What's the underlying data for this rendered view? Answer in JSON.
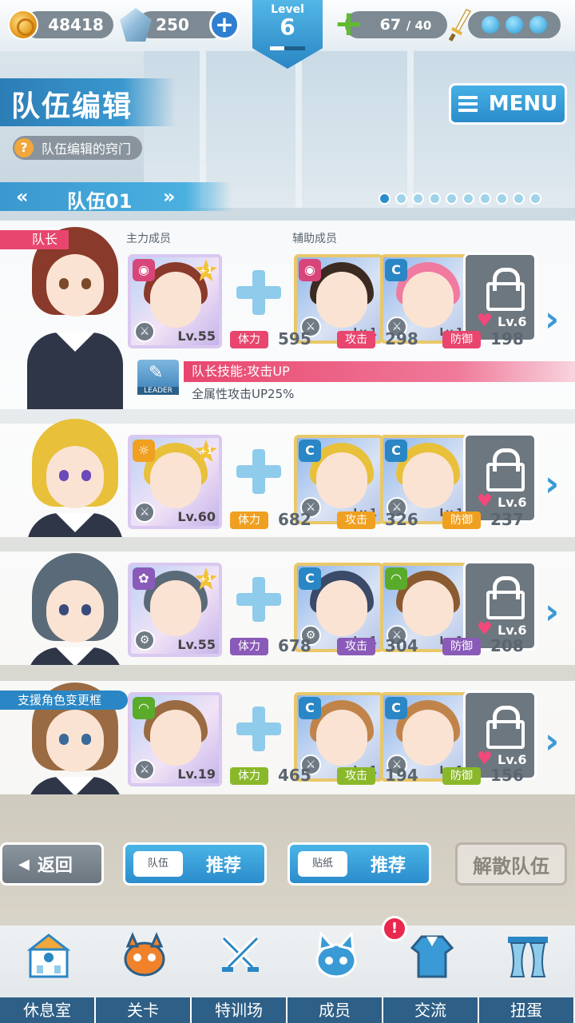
{
  "header": {
    "coins": "48418",
    "gems": "250",
    "level_label": "Level",
    "level_value": "6",
    "level_progress": 0.4,
    "stamina_current": "67",
    "stamina_max": "/ 40"
  },
  "page": {
    "title": "队伍编辑",
    "hint": "队伍编辑的窍门",
    "menu_label": "MENU",
    "team_name": "队伍01",
    "prev_arrow": "«",
    "next_arrow": "»",
    "page_dots": 10,
    "active_dot": 0
  },
  "labels": {
    "main_member": "主力成员",
    "support_member": "辅助成员",
    "leader": "队长",
    "support_change": "支援角色变更框",
    "hp": "体力",
    "atk": "攻击",
    "def": "防御",
    "leader_badge": "LEADER"
  },
  "leader_skill": {
    "name": "队长技能:攻击UP",
    "desc": "全属性攻击UP25%"
  },
  "rows": [
    {
      "main_level": "Lv.55",
      "main_plus": "+1",
      "sub1_level": "Lv.1",
      "sub2_level": "Lv.1",
      "lock_level": "Lv.6",
      "hp": "595",
      "atk": "298",
      "def": "198",
      "tag_color": "#e8466e",
      "attr_color": "#d8457a"
    },
    {
      "main_level": "Lv.60",
      "main_plus": "+1",
      "sub1_level": "Lv.1",
      "sub2_level": "Lv.1",
      "lock_level": "Lv.6",
      "hp": "682",
      "atk": "326",
      "def": "237",
      "tag_color": "#f0a020",
      "attr_color": "#f0a020"
    },
    {
      "main_level": "Lv.55",
      "main_plus": "+1",
      "sub1_level": "Lv.1",
      "sub2_level": "Lv.1",
      "lock_level": "Lv.6",
      "hp": "678",
      "atk": "304",
      "def": "208",
      "tag_color": "#8a5ab8",
      "attr_color": "#8a5ab8"
    },
    {
      "main_level": "Lv.19",
      "main_plus": "",
      "sub1_level": "Lv.1",
      "sub2_level": "Lv.1",
      "lock_level": "Lv.6",
      "hp": "465",
      "atk": "194",
      "def": "156",
      "tag_color": "#8ab82a",
      "attr_color": "#5aab2a"
    }
  ],
  "buttons": {
    "back": "返回",
    "team_tag": "队伍",
    "team_recommend": "推荐",
    "sticker_tag": "贴纸",
    "sticker_recommend": "推荐",
    "disband": "解散队伍"
  },
  "nav": {
    "items": [
      "休息室",
      "关卡",
      "特训场",
      "成员",
      "交流",
      "扭蛋"
    ],
    "badge": "!"
  }
}
